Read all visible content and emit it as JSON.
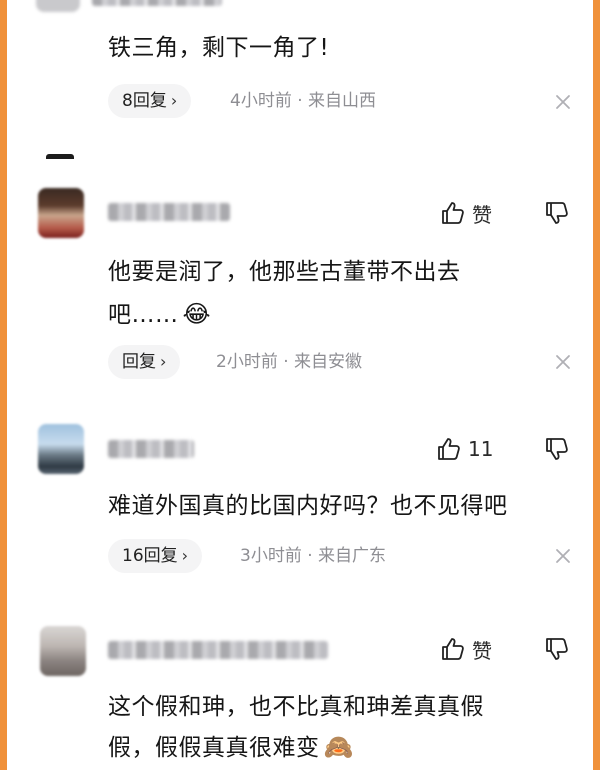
{
  "comments": [
    {
      "text_lines": [
        "铁三角，剩下一角了!"
      ],
      "reply_pill": "8回复",
      "meta": "4小时前 · 来自山西"
    },
    {
      "text_lines": [
        "他要是润了，他那些古董带不出去",
        "吧……"
      ],
      "emoji": "😂",
      "like_label": "赞",
      "reply_pill": "回复",
      "meta": "2小时前 · 来自安徽"
    },
    {
      "text_lines": [
        "难道外国真的比国内好吗？也不见得吧"
      ],
      "like_label": "11",
      "reply_pill": "16回复",
      "meta": "3小时前 · 来自广东"
    },
    {
      "text_lines": [
        "这个假和珅，也不比真和珅差真真假",
        "假，假假真真很难变"
      ],
      "emoji": "🙈",
      "like_label": "赞"
    }
  ],
  "icons": {
    "chevron": "›",
    "close": "close-icon",
    "like": "thumbs-up-icon",
    "dislike": "thumbs-down-icon"
  },
  "colors": {
    "frame_border": "#f0913a",
    "meta_text": "#8e8e93",
    "pill_bg": "#f4f4f5"
  }
}
